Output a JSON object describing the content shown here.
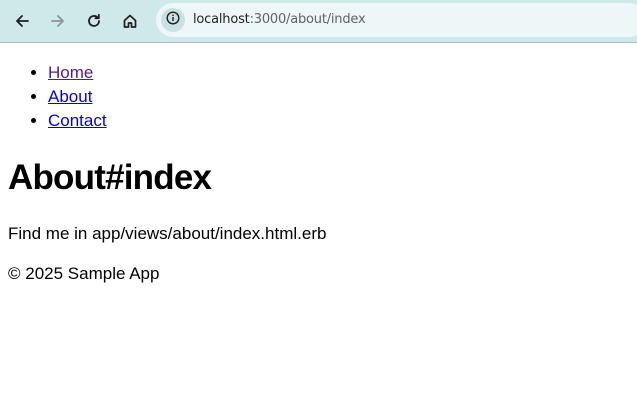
{
  "browser": {
    "url_host": "localhost",
    "url_rest": ":3000/about/index",
    "icons": {
      "back": "arrow-left-icon",
      "forward": "arrow-right-icon",
      "reload": "reload-icon",
      "home": "home-icon",
      "site_info": "info-icon"
    }
  },
  "nav": {
    "items": [
      {
        "label": "Home"
      },
      {
        "label": "About"
      },
      {
        "label": "Contact"
      }
    ]
  },
  "main": {
    "title": "About#index",
    "hint": "Find me in app/views/about/index.html.erb"
  },
  "footer": {
    "text": "© 2025 Sample App"
  },
  "colors": {
    "toolbar": "#cfe8ea",
    "omnibox": "#eef7f8",
    "link_visited": "#551a8b",
    "link_unvisited": "#0000ee"
  }
}
